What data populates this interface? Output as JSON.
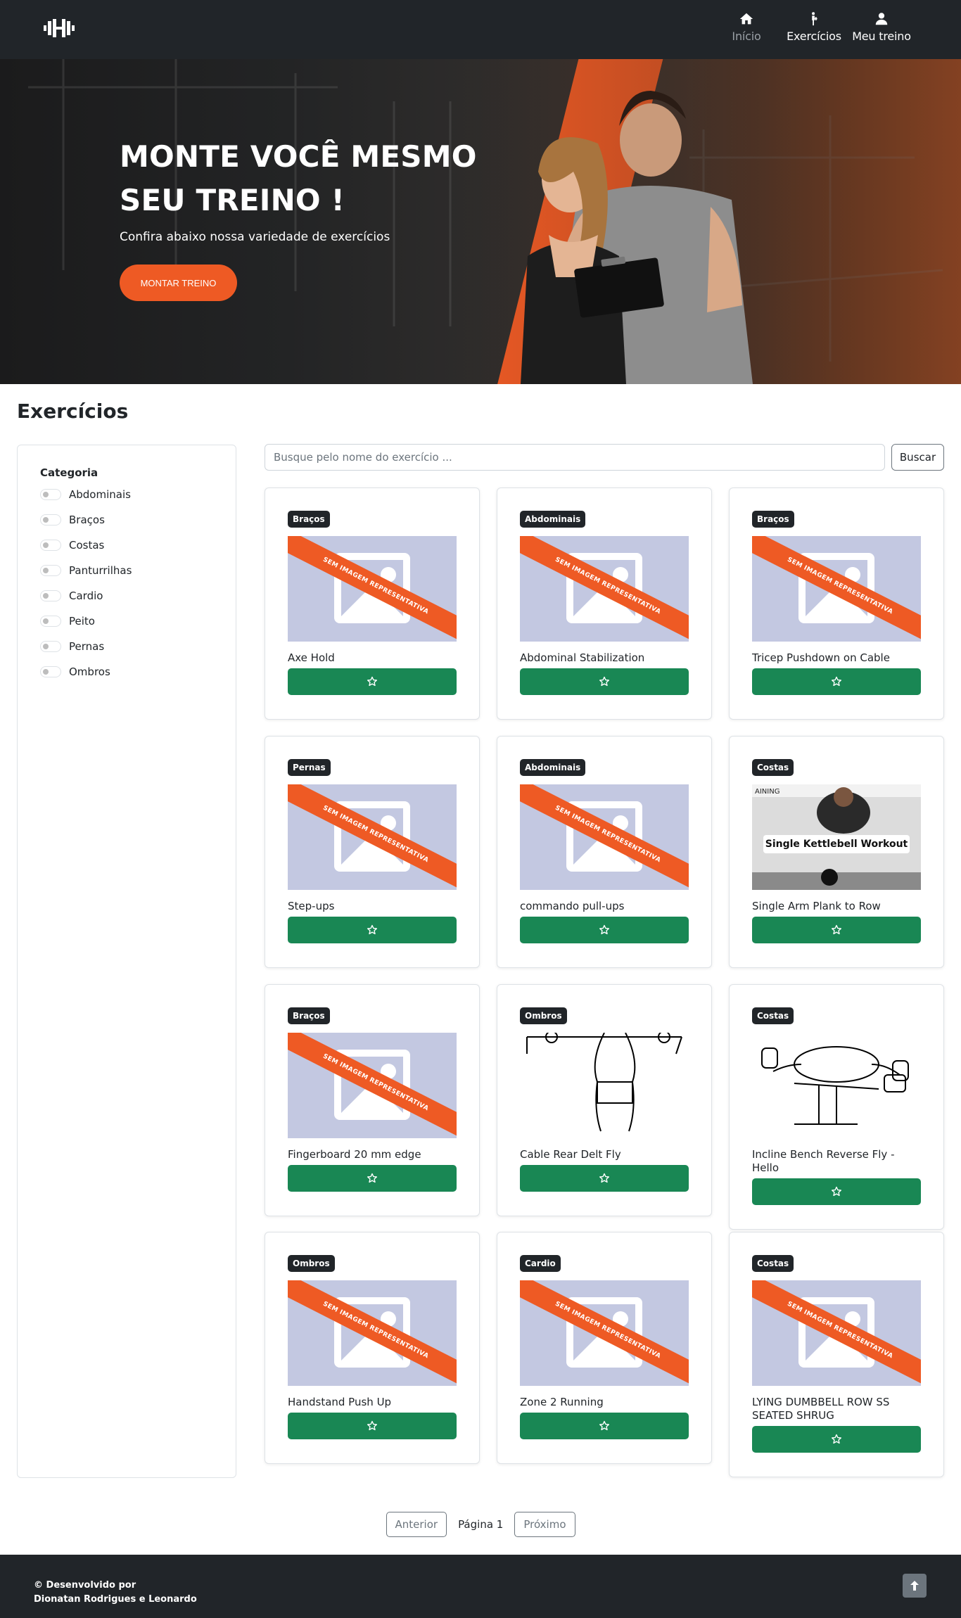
{
  "nav": {
    "items": [
      {
        "label": "Início",
        "icon": "home-icon"
      },
      {
        "label": "Exercícios",
        "icon": "exercise-icon"
      },
      {
        "label": "Meu treino",
        "icon": "user-icon"
      }
    ]
  },
  "hero": {
    "title": "MONTE VOCÊ MESMO SEU TREINO !",
    "subtitle": "Confira abaixo nossa variedade de exercícios",
    "cta_label": "MONTAR TREINO",
    "accent_color": "#ee5a24"
  },
  "section": {
    "title": "Exercícios"
  },
  "sidebar": {
    "category_title": "Categoria",
    "categories": [
      "Abdominais",
      "Braços",
      "Costas",
      "Panturrilhas",
      "Cardio",
      "Peito",
      "Pernas",
      "Ombros"
    ]
  },
  "search": {
    "placeholder": "Busque pelo nome do exercício ...",
    "button_label": "Buscar"
  },
  "placeholder_banner": "SEM IMAGEM REPRESENTATIVA",
  "thumb_caption": "Single Kettlebell Workout",
  "cards": [
    {
      "category": "Braços",
      "name": "Axe Hold",
      "image": "placeholder"
    },
    {
      "category": "Abdominais",
      "name": "Abdominal Stabilization",
      "image": "placeholder"
    },
    {
      "category": "Braços",
      "name": "Tricep Pushdown on Cable",
      "image": "placeholder"
    },
    {
      "category": "Pernas",
      "name": "Step-ups",
      "image": "placeholder"
    },
    {
      "category": "Abdominais",
      "name": "commando pull-ups",
      "image": "placeholder"
    },
    {
      "category": "Costas",
      "name": "Single Arm Plank to Row",
      "image": "photo"
    },
    {
      "category": "Braços",
      "name": "Fingerboard 20 mm edge",
      "image": "placeholder"
    },
    {
      "category": "Ombros",
      "name": "Cable Rear Delt Fly",
      "image": "drawing"
    },
    {
      "category": "Costas",
      "name": "Incline Bench Reverse Fly - Hello",
      "image": "drawing"
    },
    {
      "category": "Ombros",
      "name": "Handstand Push Up",
      "image": "placeholder"
    },
    {
      "category": "Cardio",
      "name": "Zone 2 Running",
      "image": "placeholder"
    },
    {
      "category": "Costas",
      "name": "LYING DUMBBELL ROW SS SEATED SHRUG",
      "image": "placeholder"
    }
  ],
  "pagination": {
    "prev_label": "Anterior",
    "page_label": "Página 1",
    "next_label": "Próximo"
  },
  "footer": {
    "credit_line1": "© Desenvolvido por",
    "credit_line2": "Dionatan Rodrigues e Leonardo"
  },
  "colors": {
    "dark": "#212529",
    "accent": "#ee5a24",
    "favorite_button": "#198754",
    "placeholder_bg": "#c3c8e1"
  }
}
